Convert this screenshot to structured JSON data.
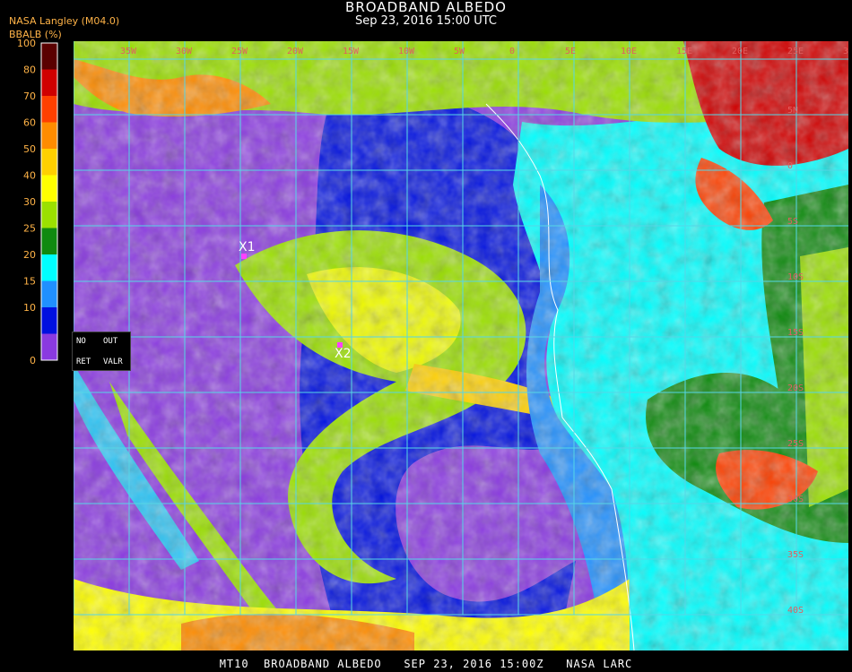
{
  "header": {
    "title": "BROADBAND ALBEDO",
    "subtitle": "Sep 23, 2016 15:00 UTC",
    "producer": "NASA Langley (M04.0)",
    "product_label": "BBALB (%)"
  },
  "legend": {
    "ticks": [
      "100",
      "80",
      "70",
      "60",
      "50",
      "40",
      "30",
      "25",
      "20",
      "15",
      "10",
      "0"
    ],
    "bands": [
      {
        "color": "#5a0000"
      },
      {
        "color": "#d00000"
      },
      {
        "color": "#ff4000"
      },
      {
        "color": "#ff8c00"
      },
      {
        "color": "#ffd000"
      },
      {
        "color": "#ffff00"
      },
      {
        "color": "#9be000"
      },
      {
        "color": "#108a10"
      },
      {
        "color": "#00ffff"
      },
      {
        "color": "#2090ff"
      },
      {
        "color": "#0010e0"
      },
      {
        "color": "#8a3ae0"
      }
    ]
  },
  "status_box": {
    "no": "NO",
    "out": "OUT",
    "ret": "RET",
    "valr": "VALR"
  },
  "markers": [
    {
      "label": "X1",
      "color": "#ff40ff"
    },
    {
      "label": "X2",
      "color": "#ff40ff"
    }
  ],
  "map": {
    "graticule_color": "#55d6e6",
    "top_labels": [
      "35W",
      "30W",
      "25W",
      "20W",
      "15W",
      "10W",
      "5W",
      "0",
      "5E",
      "10E",
      "15E",
      "20E",
      "25E",
      "30E",
      "35E"
    ],
    "right_labels": [
      "5N",
      "0",
      "5S",
      "10S",
      "15S",
      "20S",
      "25S",
      "30S",
      "35S",
      "40S"
    ]
  },
  "footer": "MT10  BROADBAND ALBEDO   SEP 23, 2016 15:00Z   NASA LARC"
}
